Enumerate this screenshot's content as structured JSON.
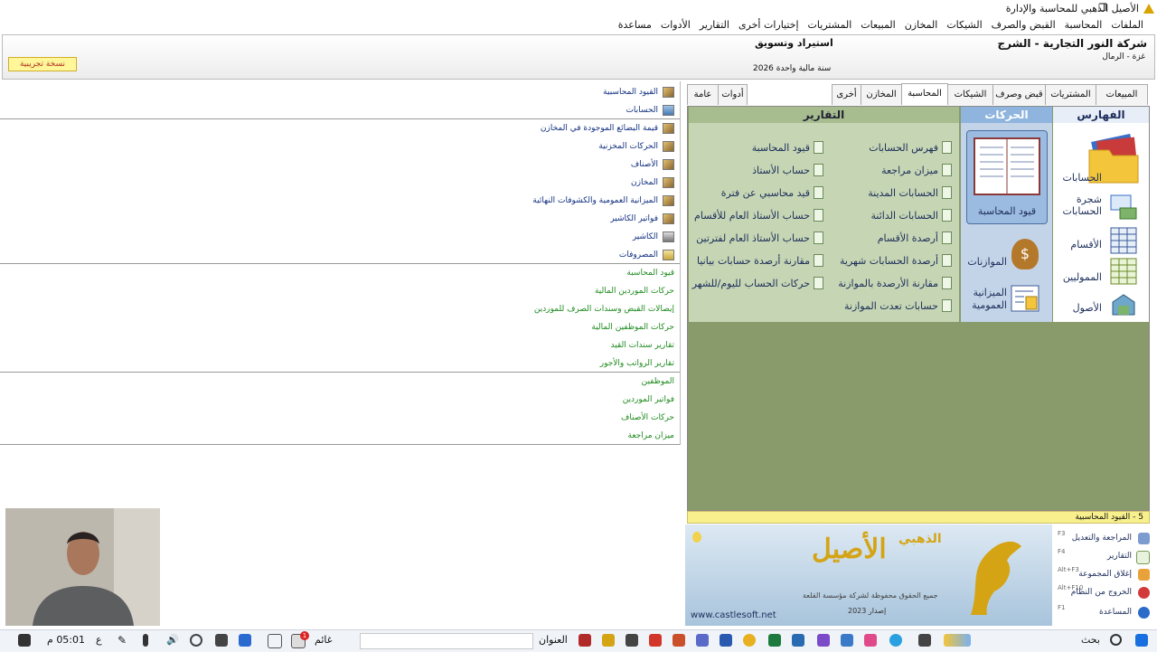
{
  "window": {
    "title": "الأصيل الذهبي للمحاسبة والإدارة",
    "restore_glyph": "❐"
  },
  "menu": [
    "الملفات",
    "المحاسبة",
    "القبض والصرف",
    "الشيكات",
    "المخازن",
    "المبيعات",
    "المشتريات",
    "إختيارات أخرى",
    "التقارير",
    "الأدوات",
    "مساعدة"
  ],
  "company": {
    "name": "شركة النور التجارية - الشرج",
    "location": "غزة - الرمال",
    "activity": "استيراد وتسويق",
    "fiscal_year": "سنة مالية واحدة 2026",
    "trial_label": "نسخة تجريبية"
  },
  "tree": {
    "items": [
      {
        "label": "القيود المحاسبية",
        "icon": "ledger-icon"
      },
      {
        "label": "الحسابات",
        "icon": "accounts-icon"
      },
      {
        "label": "قيمة البضائع الموجودة في المخازن",
        "icon": "goods-icon"
      },
      {
        "label": "الحركات المخزنية",
        "icon": "stock-moves-icon"
      },
      {
        "label": "الأصناف",
        "icon": "items-icon"
      },
      {
        "label": "المخازن",
        "icon": "warehouse-icon"
      },
      {
        "label": "الميزانية العمومية والكشوفات النهائية",
        "icon": "balance-icon"
      },
      {
        "label": "فواتير الكاشير",
        "icon": "cashier-invoices-icon"
      },
      {
        "label": "الكاشير",
        "icon": "cashier-icon"
      },
      {
        "label": "المصروفات",
        "icon": "expenses-icon"
      }
    ],
    "green_group1": [
      "قيود المحاسبة",
      "حركات الموردين المالية",
      "إيصالات القبض وسندات الصرف للموردين",
      "حركات الموظفين المالية",
      "تقارير سندات القيد",
      "تقارير الرواتب والأجور"
    ],
    "green_group2": [
      "الموظفين",
      "فواتير الموردين",
      "حركات الأصناف",
      "ميزان مراجعة"
    ]
  },
  "tabs": [
    "المبيعات",
    "المشتريات",
    "قبض وصرف",
    "الشيكات",
    "المحاسبة",
    "المخازن",
    "أخرى",
    "أدوات",
    "عامة"
  ],
  "active_tab": "المحاسبة",
  "sections": {
    "index": {
      "title": "الفهارس",
      "items": [
        "الحسابات",
        "شجرة الحسابات",
        "الأقسام",
        "المموليين",
        "الأصول"
      ]
    },
    "moves": {
      "title": "الحركات",
      "items": [
        "قيود المحاسبة",
        "الموازنات",
        "الميزانية العمومية"
      ]
    },
    "reports": {
      "title": "التقارير",
      "col_right": [
        "فهرس الحسابات",
        "ميزان مراجعة",
        "الحسابات المدينة",
        "الحسابات الدائنة",
        "أرصدة الأقسام",
        "أرصدة الحسابات شهرية",
        "مقارنة الأرصدة بالموازنة",
        "حسابات تعدت الموازنة"
      ],
      "col_left": [
        "قيود المحاسبة",
        "حساب الأستاذ",
        "قيد محاسبي عن فترة",
        "حساب الأستاذ العام للأقسام",
        "حساب الأستاذ العام لفترتين",
        "مقارنة أرصدة حسابات بيانيا",
        "حركات الحساب لليوم/للشهر"
      ]
    }
  },
  "status_line": "5 - القيود المحاسبية",
  "banner": {
    "logo_text": "الأصيل",
    "logo_small": "الذهبي",
    "rights": "جميع الحقوق محفوظة لشركة مؤسسة القلعة",
    "version": "إصدار 2023",
    "url": "www.castlesoft.net"
  },
  "quick": [
    {
      "label": "المراجعة والتعديل",
      "key": "F3"
    },
    {
      "label": "التقارير",
      "key": "F4"
    },
    {
      "label": "إغلاق المجموعة",
      "key": "Alt+F3"
    },
    {
      "label": "الخروج من النظام",
      "key": "Alt+F10"
    },
    {
      "label": "المساعدة",
      "key": "F1"
    }
  ],
  "taskbar": {
    "search": "بحث",
    "address": "العنوان",
    "weather": "غائم",
    "lang": "ع",
    "time": "05:01 م",
    "badge": "1"
  },
  "colors": {
    "panel_bg": "#899a6b",
    "reports_bg": "#c6d6b4",
    "moves_bg": "#c4d4e8",
    "accent_gold": "#d4a414"
  }
}
